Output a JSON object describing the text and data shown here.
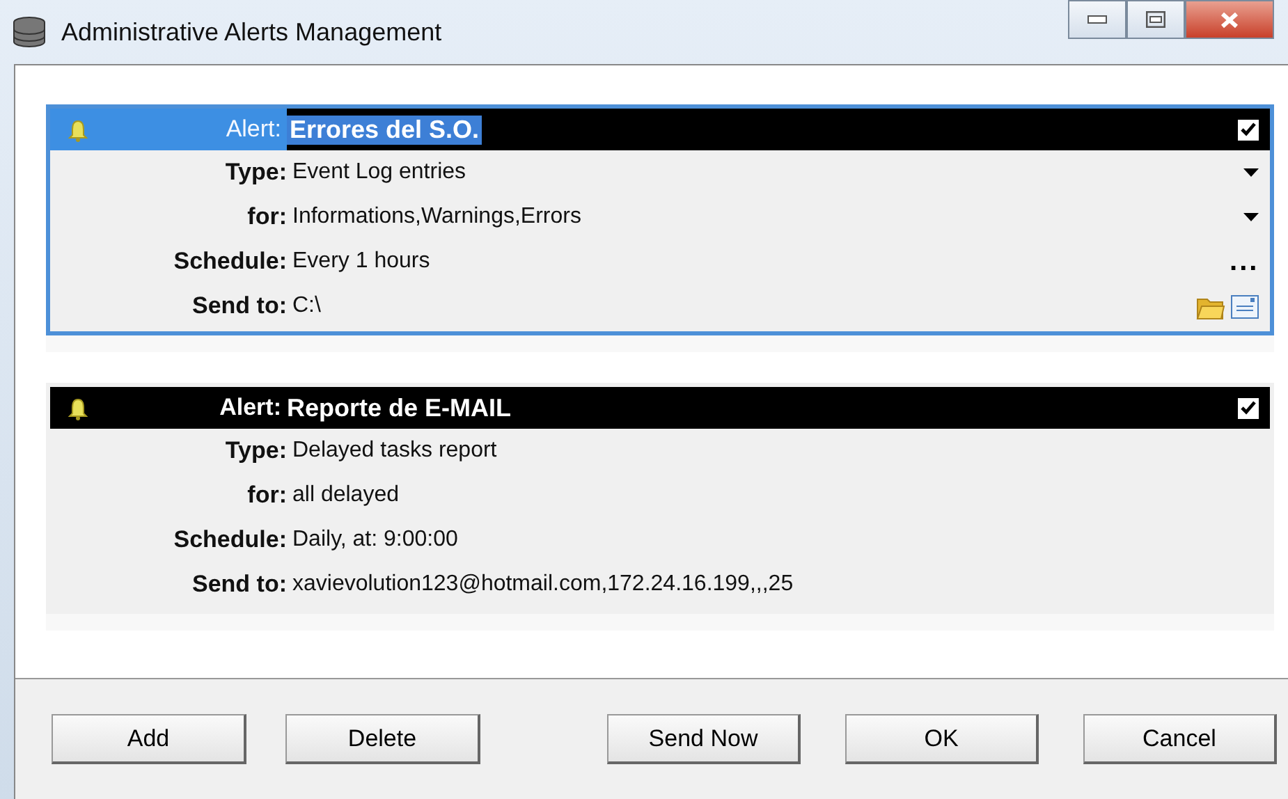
{
  "window": {
    "title": "Administrative Alerts Management"
  },
  "alerts": [
    {
      "selected": true,
      "enabled": true,
      "label": "Alert:",
      "name": "Errores del S.O.",
      "fields": [
        {
          "label": "Type:",
          "value": "Event Log entries",
          "kind": "dropdown"
        },
        {
          "label": "for:",
          "value": "Informations,Warnings,Errors",
          "kind": "dropdown"
        },
        {
          "label": "Schedule:",
          "value": "Every 1 hours",
          "kind": "ellipsis",
          "button_text": "..."
        },
        {
          "label": "Send to:",
          "value": "C:\\",
          "kind": "browse"
        }
      ]
    },
    {
      "selected": false,
      "enabled": true,
      "label": "Alert:",
      "name": "Reporte de E-MAIL",
      "fields": [
        {
          "label": "Type:",
          "value": "Delayed tasks report"
        },
        {
          "label": "for:",
          "value": "all delayed"
        },
        {
          "label": "Schedule:",
          "value": "Daily, at: 9:00:00"
        },
        {
          "label": "Send to:",
          "value": "xavievolution123@hotmail.com,172.24.16.199,,,25"
        }
      ]
    }
  ],
  "buttons_left": [
    "Add",
    "Delete"
  ],
  "buttons_right": [
    "Send Now",
    "OK",
    "Cancel"
  ]
}
